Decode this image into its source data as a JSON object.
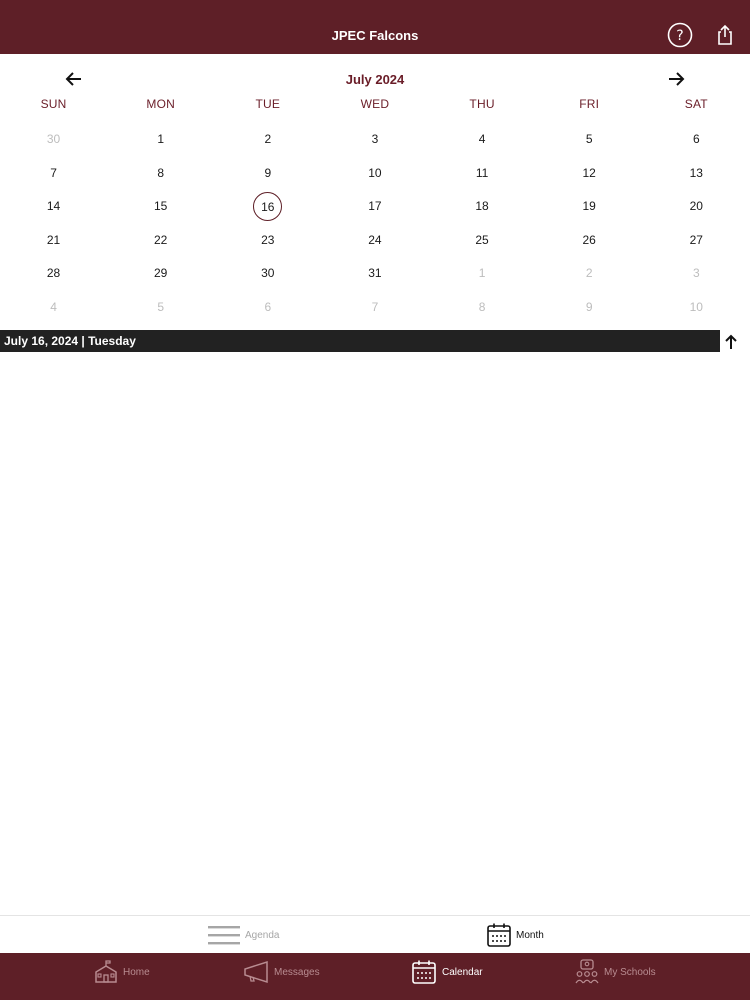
{
  "app": {
    "title": "JPEC Falcons"
  },
  "calendar": {
    "month_label": "July 2024",
    "weekdays": [
      "SUN",
      "MON",
      "TUE",
      "WED",
      "THU",
      "FRI",
      "SAT"
    ],
    "weeks": [
      [
        {
          "d": "30",
          "other": true
        },
        {
          "d": "1"
        },
        {
          "d": "2"
        },
        {
          "d": "3"
        },
        {
          "d": "4"
        },
        {
          "d": "5"
        },
        {
          "d": "6"
        }
      ],
      [
        {
          "d": "7"
        },
        {
          "d": "8"
        },
        {
          "d": "9"
        },
        {
          "d": "10"
        },
        {
          "d": "11"
        },
        {
          "d": "12"
        },
        {
          "d": "13"
        }
      ],
      [
        {
          "d": "14"
        },
        {
          "d": "15"
        },
        {
          "d": "16",
          "today": true
        },
        {
          "d": "17"
        },
        {
          "d": "18"
        },
        {
          "d": "19"
        },
        {
          "d": "20"
        }
      ],
      [
        {
          "d": "21"
        },
        {
          "d": "22"
        },
        {
          "d": "23"
        },
        {
          "d": "24"
        },
        {
          "d": "25"
        },
        {
          "d": "26"
        },
        {
          "d": "27"
        }
      ],
      [
        {
          "d": "28"
        },
        {
          "d": "29"
        },
        {
          "d": "30"
        },
        {
          "d": "31"
        },
        {
          "d": "1",
          "other": true
        },
        {
          "d": "2",
          "other": true
        },
        {
          "d": "3",
          "other": true
        }
      ],
      [
        {
          "d": "4",
          "other": true
        },
        {
          "d": "5",
          "other": true
        },
        {
          "d": "6",
          "other": true
        },
        {
          "d": "7",
          "other": true
        },
        {
          "d": "8",
          "other": true
        },
        {
          "d": "9",
          "other": true
        },
        {
          "d": "10",
          "other": true
        }
      ]
    ],
    "selected_date_label": "July 16, 2024 | Tuesday"
  },
  "view_toggle": {
    "agenda_label": "Agenda",
    "month_label": "Month"
  },
  "tabbar": {
    "home_label": "Home",
    "messages_label": "Messages",
    "calendar_label": "Calendar",
    "schools_label": "My Schools"
  },
  "colors": {
    "brand": "#5e1f27",
    "accent_text": "#6a1d28",
    "selected_bar": "#222222"
  },
  "icons": {
    "help": "help-circle-icon",
    "share": "share-icon",
    "prev": "arrow-left-icon",
    "next": "arrow-right-icon",
    "scroll_up": "arrow-up-icon",
    "agenda": "list-icon",
    "month": "calendar-grid-icon",
    "home": "school-house-icon",
    "messages": "megaphone-icon",
    "calendar": "calendar-icon",
    "schools": "people-group-icon"
  }
}
